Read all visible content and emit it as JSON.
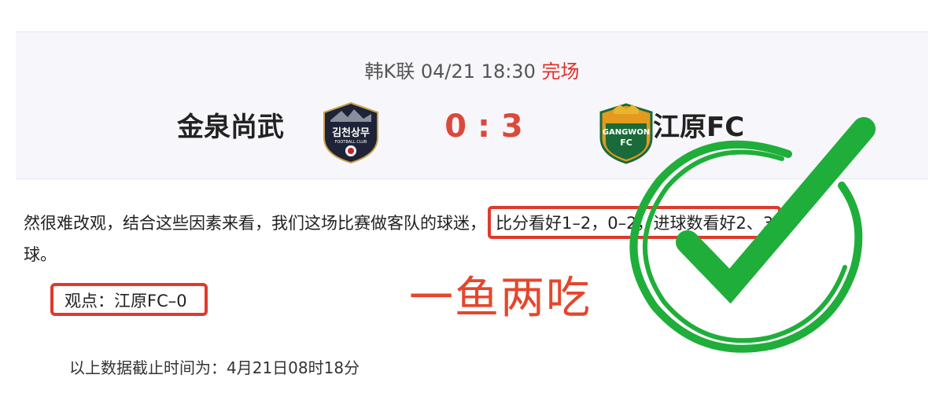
{
  "match": {
    "league": "韩K联",
    "datetime": "04/21 18:30",
    "status": "完场",
    "home_team": "金泉尚武",
    "away_team": "江原FC",
    "score": "0 : 3",
    "home_logo_text": "김천상무",
    "home_logo_sub": "FOOTBALL CLUB",
    "away_logo_text": "GANGWON",
    "away_logo_sub": "FC"
  },
  "article": {
    "paragraph_start": "然很难改观，结合这些因素来看，我们这场比赛做客队的球迷，",
    "highlight": "比分看好1–2，0–2，进球数看好2、3",
    "paragraph_end": "球。",
    "viewpoint": "观点：江原FC–0",
    "slogan": "一鱼两吃",
    "footnote": "以上数据截止时间为：4月21日08时18分"
  },
  "colors": {
    "accent_red": "#e0392c",
    "score_red": "#d94a3b",
    "check_green": "#1fae3a"
  },
  "icons": {
    "home_logo": "gimcheon-sangmu-crest",
    "away_logo": "gangwon-fc-crest",
    "check": "green-check-circle"
  }
}
